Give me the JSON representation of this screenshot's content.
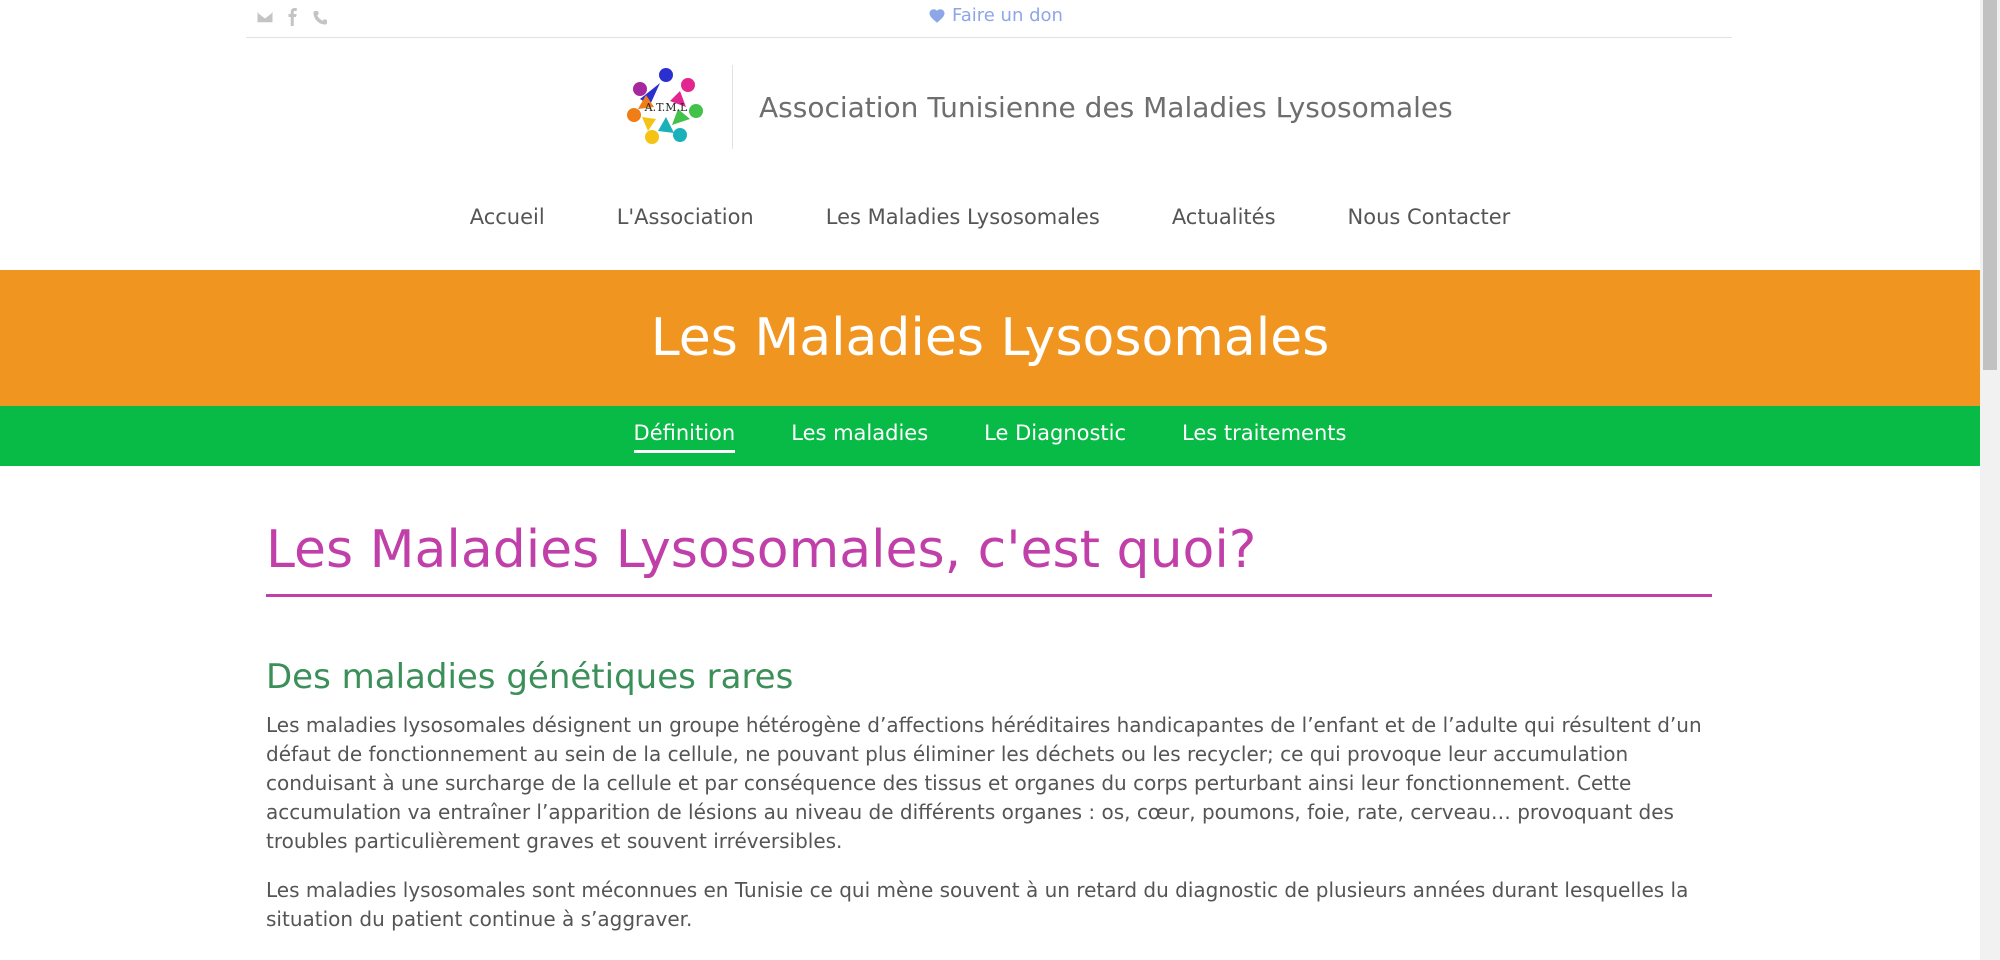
{
  "topbar": {
    "icons": [
      "envelope-icon",
      "facebook-icon",
      "phone-icon"
    ],
    "donate_label": "Faire un don"
  },
  "brand": {
    "logo_text": "A.T.M.L",
    "title": "Association Tunisienne des Maladies Lysosomales"
  },
  "nav": {
    "items": [
      "Accueil",
      "L'Association",
      "Les Maladies Lysosomales",
      "Actualités",
      "Nous Contacter"
    ]
  },
  "banner": {
    "title": "Les Maladies Lysosomales"
  },
  "subnav": {
    "items": [
      "Définition",
      "Les maladies",
      "Le Diagnostic",
      "Les traitements"
    ],
    "active": "Définition"
  },
  "content": {
    "title": "Les Maladies Lysosomales, c'est quoi?",
    "section_title": "Des maladies génétiques rares",
    "paragraphs": [
      "Les maladies lysosomales désignent un groupe hétérogène d’affections héréditaires handicapantes de l’enfant et de l’adulte qui résultent d’un défaut de fonctionnement au sein de la cellule, ne pouvant plus éliminer les déchets ou les recycler; ce qui provoque leur accumulation conduisant à une surcharge de la cellule et par conséquence des tissus et organes du corps perturbant ainsi leur fonctionnement. Cette accumulation va entraîner l’apparition de lésions au niveau de différents organes : os, cœur, poumons, foie, rate, cerveau… provoquant des troubles particulièrement graves et souvent irréversibles.",
      "Les maladies lysosomales sont méconnues en Tunisie ce qui mène souvent à un retard du diagnostic de plusieurs années durant lesquelles la situation du patient continue à s’aggraver."
    ]
  },
  "colors": {
    "banner": "#f09520",
    "subnav": "#07bb46",
    "title": "#c13fa9",
    "section": "#3b8f58",
    "donate": "#8da6e8"
  }
}
